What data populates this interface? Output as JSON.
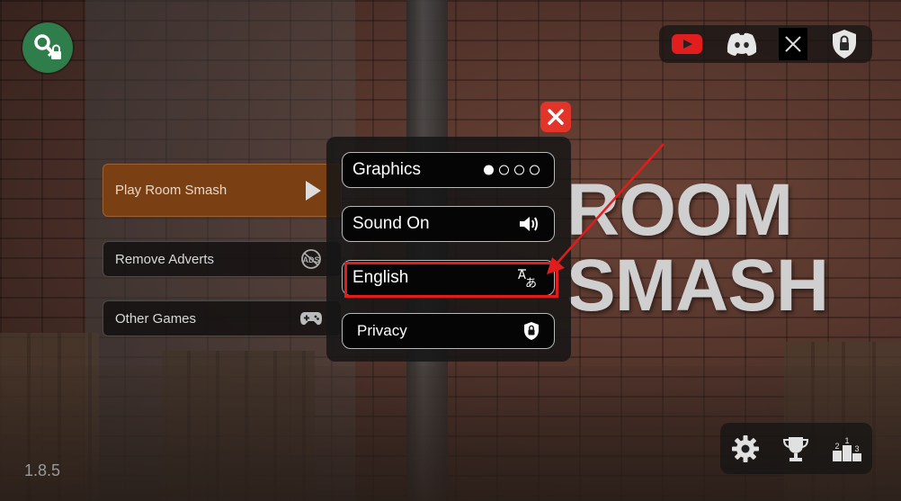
{
  "title": {
    "line1": "ROOM",
    "line2": "SMASH"
  },
  "menu": {
    "play_label": "Play Room Smash",
    "remove_ads_label": "Remove Adverts",
    "other_games_label": "Other Games"
  },
  "settings": {
    "graphics_label": "Graphics",
    "graphics_level": 1,
    "graphics_levels_total": 4,
    "sound_label": "Sound On",
    "language_label": "English",
    "privacy_label": "Privacy"
  },
  "social": [
    "youtube-icon",
    "discord-icon",
    "x-icon",
    "privacy-shield-icon"
  ],
  "bottom_bar": [
    "settings-gear-icon",
    "trophy-icon",
    "leaderboard-podium-icon"
  ],
  "version": "1.8.5",
  "colors": {
    "play_button": "#7a3f12",
    "close_button": "#e3342a",
    "annotation": "#e21c1c",
    "key_button": "#2e7d4b"
  }
}
